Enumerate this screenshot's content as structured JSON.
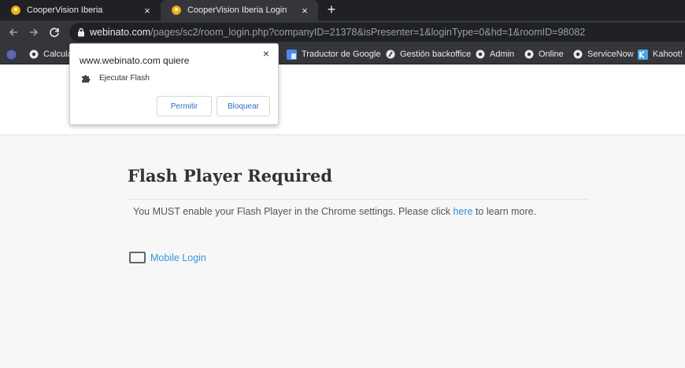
{
  "tabs": [
    {
      "title": "CooperVision Iberia",
      "close": "×"
    },
    {
      "title": "CooperVision Iberia Login",
      "close": "×"
    }
  ],
  "new_tab": "+",
  "address_bar": {
    "host": "webinato.com",
    "path": "/pages/sc2/room_login.php?companyID=21378&isPresenter=1&loginType=0&hd=1&roomID=98082"
  },
  "bookmarks": [
    {
      "label": "Calcula",
      "icon": "chrome-icon"
    },
    {
      "label": "Traductor de Google",
      "icon": "google-translate-icon"
    },
    {
      "label": "Gestión backoffice",
      "icon": "feather-icon"
    },
    {
      "label": "Admin",
      "icon": "chrome-icon"
    },
    {
      "label": "Online",
      "icon": "chrome-icon"
    },
    {
      "label": "ServiceNow",
      "icon": "chrome-icon"
    },
    {
      "label": "Kahoot!",
      "icon": "kahoot-icon"
    }
  ],
  "popup": {
    "origin": "www.webinato.com quiere",
    "close": "×",
    "permission": "Ejecutar Flash",
    "allow_label": "Permitir",
    "block_label": "Bloquear"
  },
  "main": {
    "heading": "Flash Player Required",
    "message_before": "You MUST enable your Flash Player in the Chrome settings. Please click ",
    "message_link": "here",
    "message_after": " to learn more.",
    "mobile_login": "Mobile Login"
  },
  "colors": {
    "tab_bg": "#202124",
    "toolbar_bg": "#35363a",
    "link": "#2a8fd8",
    "popup_button_text": "#2f6dc2"
  }
}
